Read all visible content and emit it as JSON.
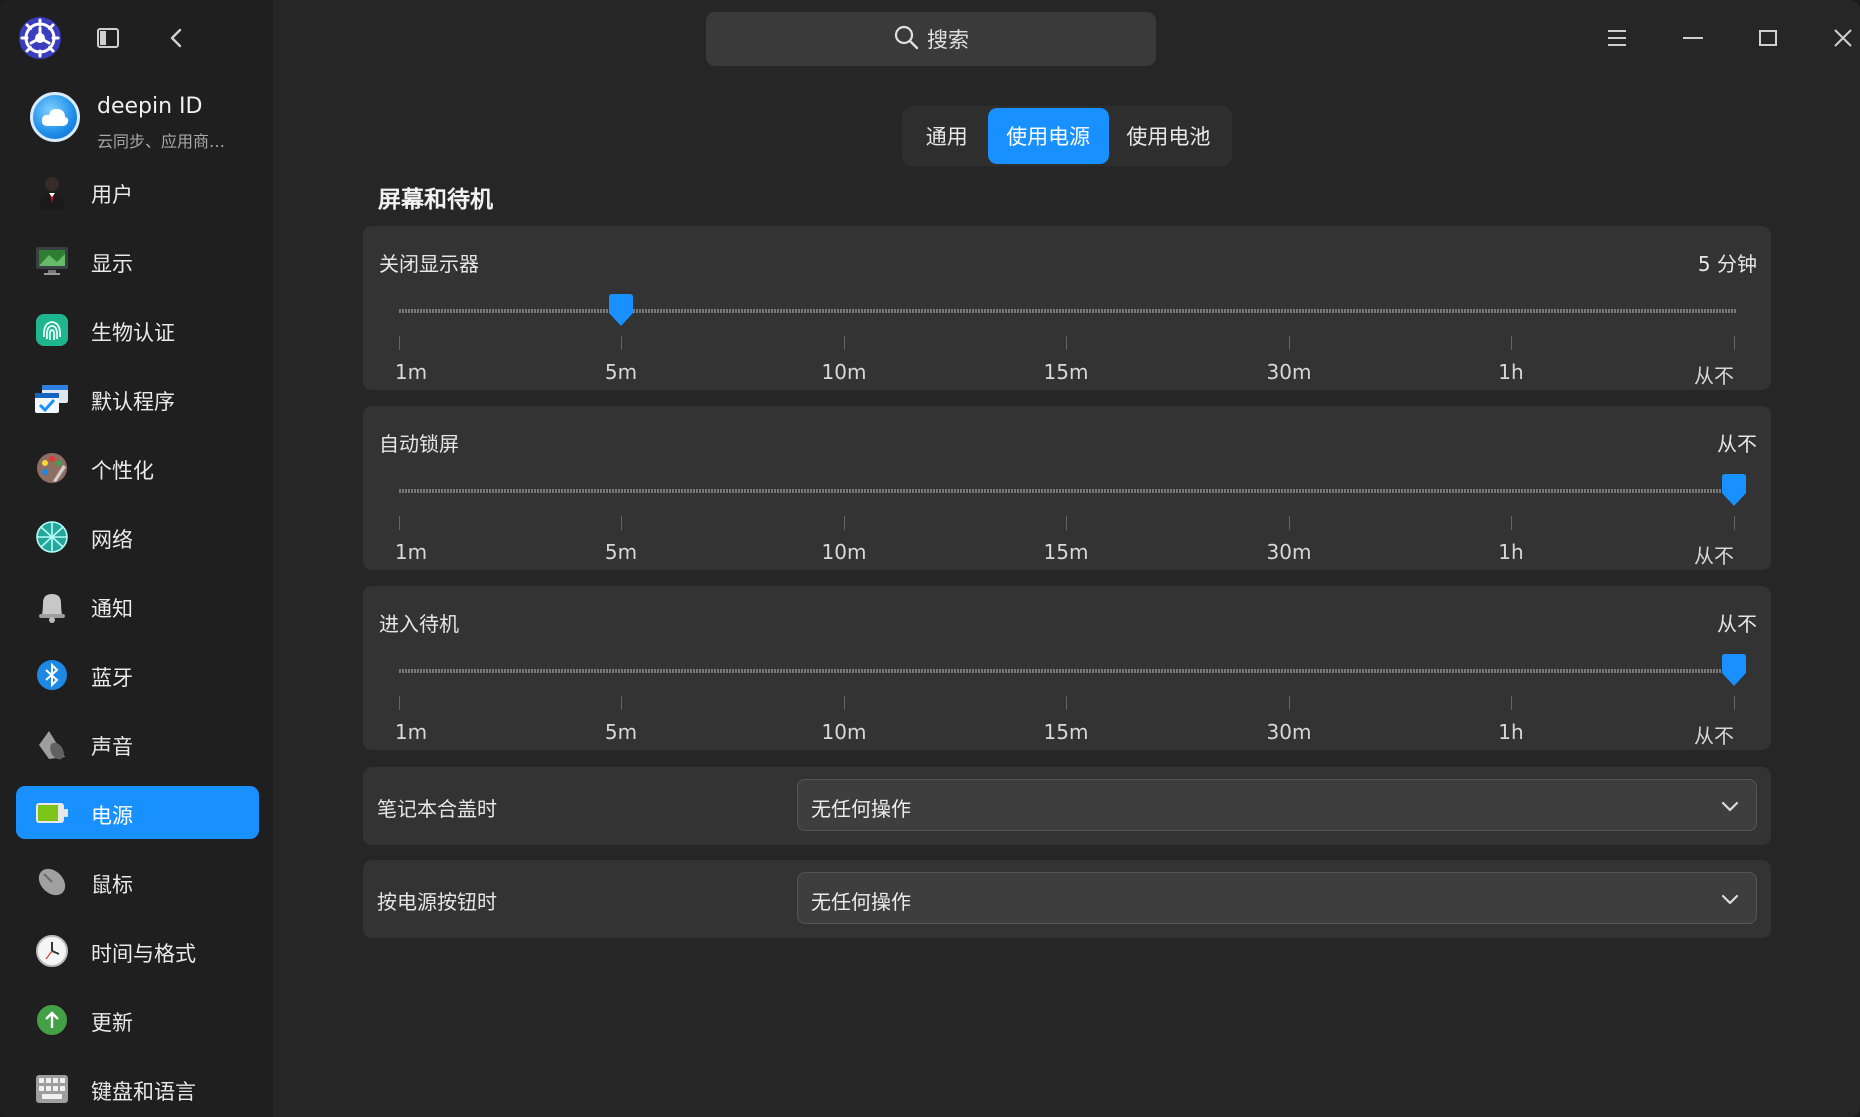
{
  "sidebar": {
    "deepin_id": {
      "name": "deepin ID",
      "subtitle": "云同步、应用商…"
    },
    "items": [
      {
        "label": "用户",
        "icon": "user-icon"
      },
      {
        "label": "显示",
        "icon": "display-icon"
      },
      {
        "label": "生物认证",
        "icon": "fingerprint-icon"
      },
      {
        "label": "默认程序",
        "icon": "default-apps-icon"
      },
      {
        "label": "个性化",
        "icon": "palette-icon"
      },
      {
        "label": "网络",
        "icon": "network-icon"
      },
      {
        "label": "通知",
        "icon": "bell-icon"
      },
      {
        "label": "蓝牙",
        "icon": "bluetooth-icon"
      },
      {
        "label": "声音",
        "icon": "speaker-icon"
      },
      {
        "label": "电源",
        "icon": "battery-icon",
        "active": true
      },
      {
        "label": "鼠标",
        "icon": "mouse-icon"
      },
      {
        "label": "时间与格式",
        "icon": "clock-icon"
      },
      {
        "label": "更新",
        "icon": "update-icon"
      },
      {
        "label": "键盘和语言",
        "icon": "keyboard-icon"
      }
    ]
  },
  "titlebar": {
    "search_placeholder": "搜索"
  },
  "tabs": [
    {
      "label": "通用"
    },
    {
      "label": "使用电源",
      "active": true
    },
    {
      "label": "使用电池"
    }
  ],
  "section": {
    "title": "屏幕和待机"
  },
  "tick_labels": [
    "1m",
    "5m",
    "10m",
    "15m",
    "30m",
    "1h",
    "从不"
  ],
  "sliders": [
    {
      "label": "关闭显示器",
      "value_text": "5 分钟",
      "selected_index": 1
    },
    {
      "label": "自动锁屏",
      "value_text": "从不",
      "selected_index": 6
    },
    {
      "label": "进入待机",
      "value_text": "从不",
      "selected_index": 6
    }
  ],
  "rows": [
    {
      "label": "笔记本合盖时",
      "value": "无任何操作"
    },
    {
      "label": "按电源按钮时",
      "value": "无任何操作"
    }
  ],
  "colors": {
    "accent": "#1890ff",
    "background": "#262626",
    "card": "#333333",
    "sidebar": "#1f1f1f"
  }
}
